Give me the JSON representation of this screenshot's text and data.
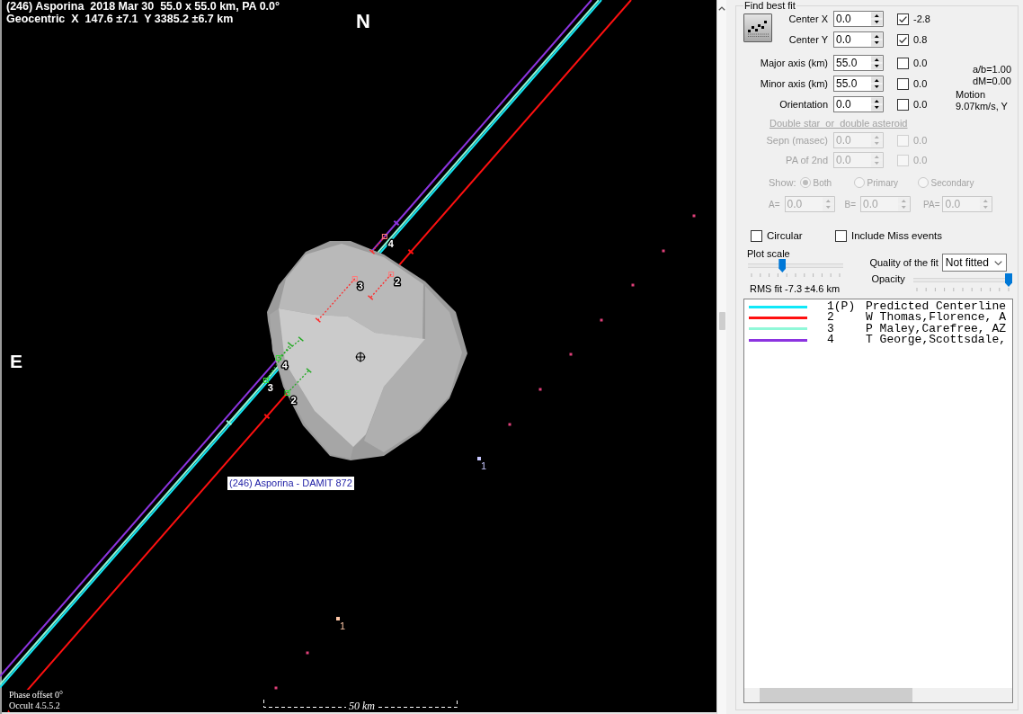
{
  "plot": {
    "title": "(246) Asporina  2018 Mar 30  55.0 x 55.0 km, PA 0.0°",
    "subtitle": "Geocentric  X  147.6 ±7.1  Y 3385.2 ±6.7 km",
    "north": "N",
    "east": "E",
    "shape_label": "(246) Asporina - DAMIT 872",
    "chord_labels": [
      "4",
      "3",
      "2",
      "4",
      "3",
      "2"
    ],
    "path_marks": [
      {
        "label": "1",
        "color": "#c8c8ff"
      },
      {
        "label": "1",
        "color": "#ffc8a8"
      }
    ],
    "scale_label": "50 km",
    "footer": [
      "Phase offset 0°",
      "Occult 4.5.5.2"
    ]
  },
  "fit_panel": {
    "title": "Find best fit",
    "params": [
      {
        "label": "Center X",
        "value": "0.0",
        "checked": true,
        "result": "-2.8"
      },
      {
        "label": "Center Y",
        "value": "0.0",
        "checked": true,
        "result": "0.8"
      },
      {
        "label": "Major axis (km)",
        "value": "55.0",
        "checked": false,
        "result": "0.0"
      },
      {
        "label": "Minor axis (km)",
        "value": "55.0",
        "checked": false,
        "result": "0.0"
      },
      {
        "label": "Orientation",
        "value": "0.0",
        "checked": false,
        "result": "0.0"
      }
    ],
    "stats": [
      "a/b=1.00",
      "dM=0.00"
    ],
    "motion": {
      "label": "Motion",
      "value": "9.07km/s, Y"
    },
    "double": {
      "title": "Double star  or  double asteroid",
      "disabled": true,
      "params": [
        {
          "label": "Sepn (masec)",
          "value": "0.0",
          "checked": false,
          "result": "0.0"
        },
        {
          "label": "PA of 2nd",
          "value": "0.0",
          "checked": false,
          "result": "0.0"
        }
      ],
      "show_label": "Show:",
      "show_options": [
        {
          "label": "Both",
          "selected": true
        },
        {
          "label": "Primary",
          "selected": false
        },
        {
          "label": "Secondary",
          "selected": false
        }
      ],
      "offsets": [
        {
          "label": "A=",
          "value": "0.0"
        },
        {
          "label": "B=",
          "value": "0.0"
        },
        {
          "label": "PA=",
          "value": "0.0"
        }
      ]
    },
    "options": [
      {
        "label": "Circular",
        "checked": false
      },
      {
        "label": "Include Miss events",
        "checked": false
      }
    ],
    "plot_scale": {
      "label": "Plot scale",
      "level": 0.35
    },
    "quality": {
      "label": "Quality of the fit",
      "value": "Not fitted"
    },
    "opacity": {
      "label": "Opacity",
      "level": 1
    },
    "rms": "RMS fit -7.3 ±4.6 km"
  },
  "legend": [
    {
      "number": "1(P)",
      "name": "Predicted Centerline",
      "color": "#10e8f8"
    },
    {
      "number": "2",
      "name": "W Thomas,Florence, A",
      "color": "#ff1010"
    },
    {
      "number": "3",
      "name": "P Maley,Carefree, AZ",
      "color": "#90f8d8"
    },
    {
      "number": "4",
      "name": "T George,Scottsdale,",
      "color": "#8c34e0"
    }
  ]
}
